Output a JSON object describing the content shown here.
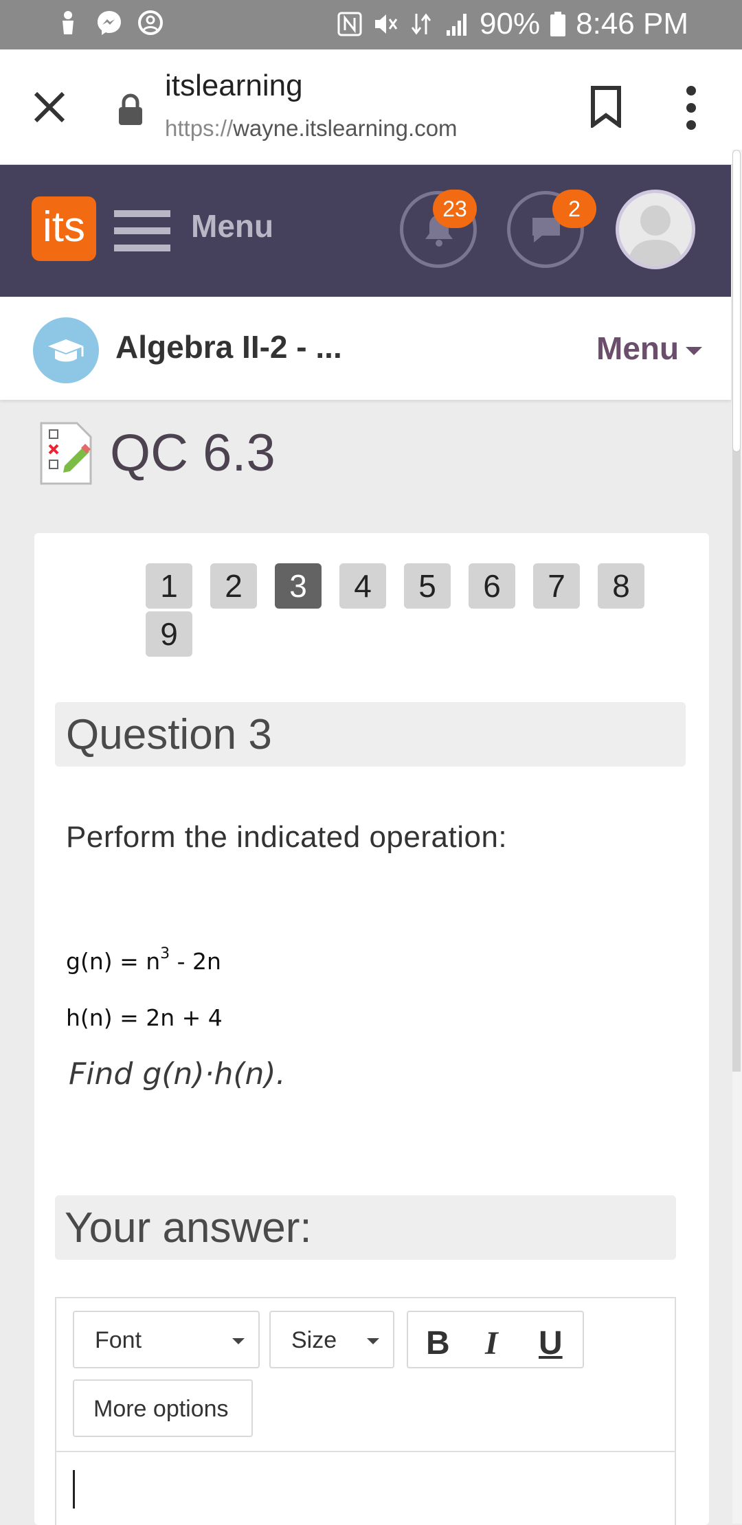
{
  "status_bar": {
    "battery": "90%",
    "time": "8:46 PM",
    "icons": [
      "user-icon",
      "messenger-icon",
      "account-circle-icon",
      "nfc-icon",
      "mute-icon",
      "data-icon",
      "signal-icon",
      "battery-icon"
    ]
  },
  "browser": {
    "site_title": "itslearning",
    "url_protocol": "https://",
    "url_host": "wayne.itslearning.com"
  },
  "app_header": {
    "logo_text": "its",
    "menu_label": "Menu",
    "notifications_count": "23",
    "messages_count": "2",
    "colors": {
      "header_bg": "#45405b",
      "accent": "#f26b12"
    }
  },
  "course": {
    "title": "Algebra II-2 - ...",
    "menu_label": "Menu"
  },
  "page": {
    "title": "QC 6.3"
  },
  "question_nav": {
    "buttons": [
      "1",
      "2",
      "3",
      "4",
      "5",
      "6",
      "7",
      "8",
      "9"
    ],
    "current": "3"
  },
  "question": {
    "heading": "Question 3",
    "prompt": "Perform the indicated operation:",
    "g_prefix": "g(n) = n",
    "g_exp": "3",
    "g_suffix": " - 2n",
    "h_line": "h(n) = 2n + 4",
    "find_line": "Find g(n)·h(n)."
  },
  "answer": {
    "heading": "Your answer:",
    "toolbar": {
      "font_label": "Font",
      "size_label": "Size",
      "bold_label": "B",
      "italic_label": "I",
      "underline_label": "U",
      "more_label": "More options"
    },
    "text": ""
  }
}
